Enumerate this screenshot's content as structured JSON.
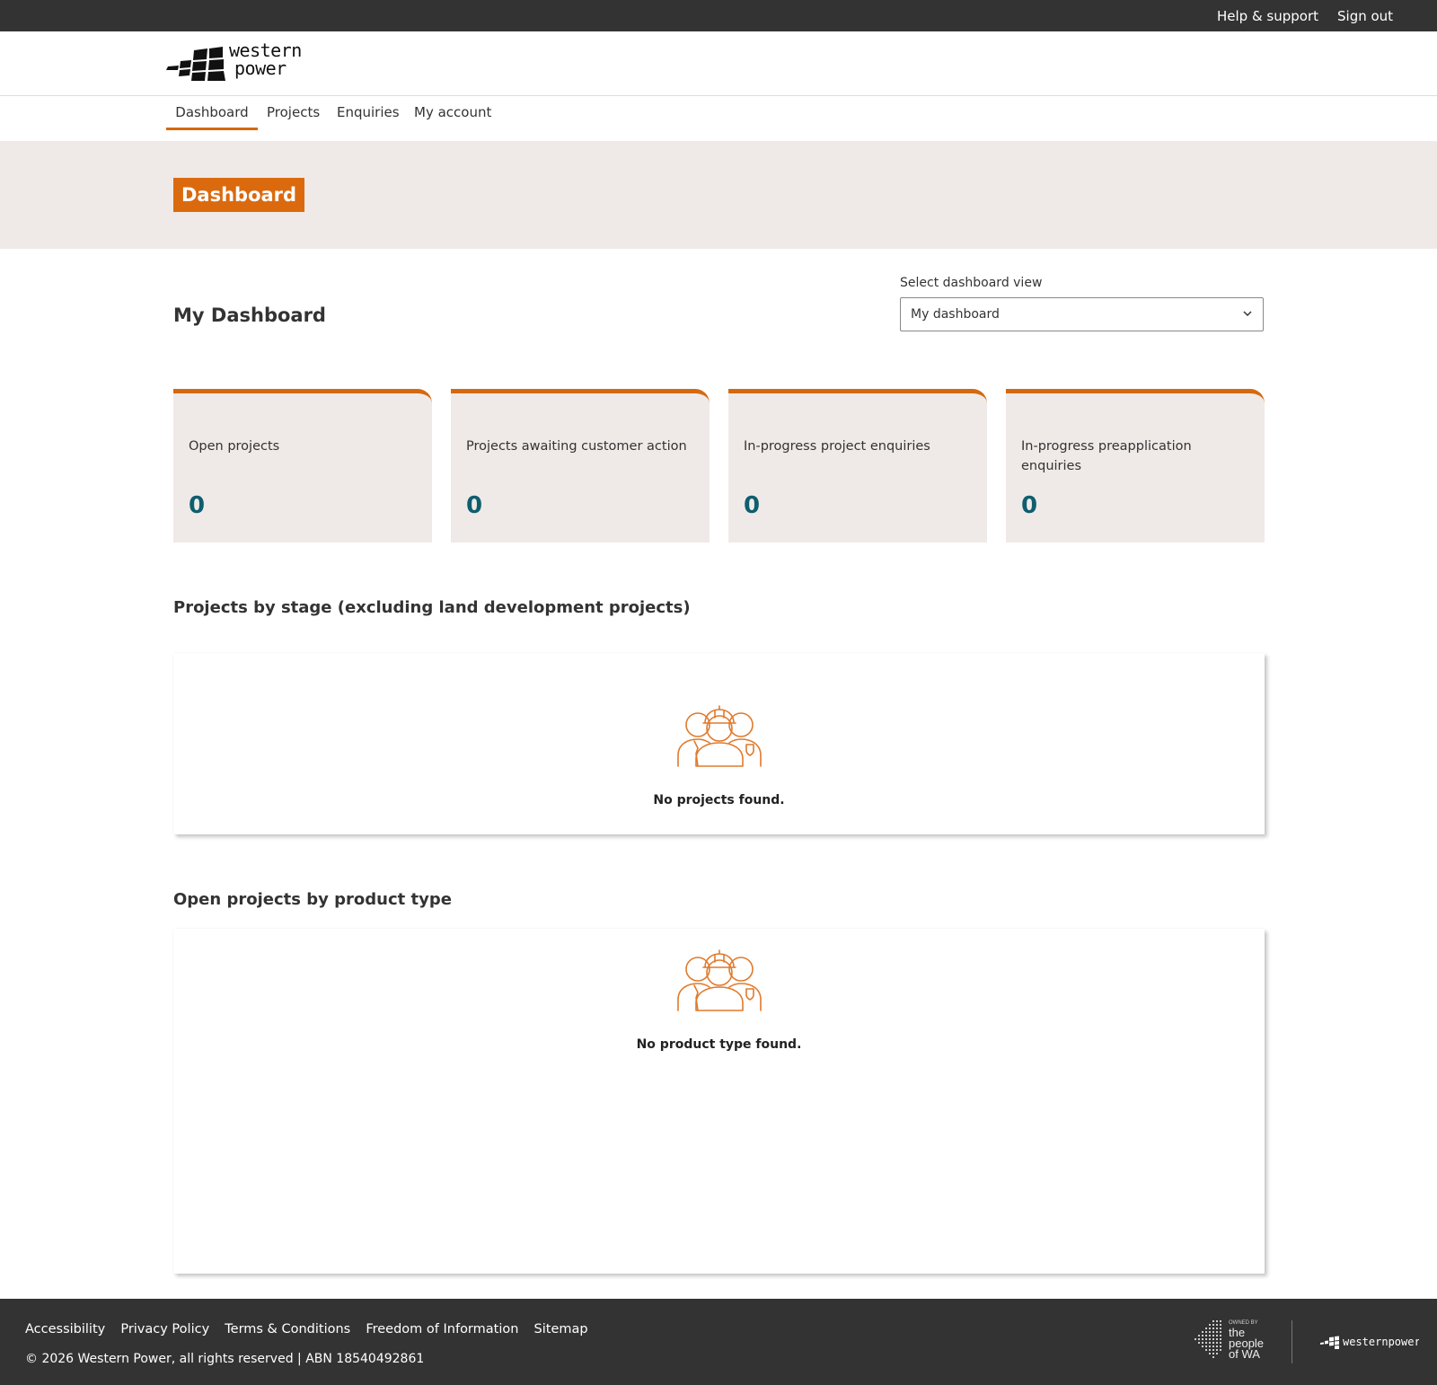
{
  "topbar": {
    "help": "Help & support",
    "signout": "Sign out"
  },
  "logo": {
    "line1": "western",
    "line2": "power"
  },
  "nav": {
    "items": [
      "Dashboard",
      "Projects",
      "Enquiries",
      "My account"
    ],
    "active": "Dashboard"
  },
  "banner": {
    "title": "Dashboard"
  },
  "main": {
    "heading": "My Dashboard",
    "select_label": "Select dashboard view",
    "select_value": "My dashboard"
  },
  "cards": [
    {
      "label": "Open projects",
      "value": "0"
    },
    {
      "label": "Projects awaiting customer action",
      "value": "0"
    },
    {
      "label": "In-progress project enquiries",
      "value": "0"
    },
    {
      "label": "In-progress preapplication enquiries",
      "value": "0"
    }
  ],
  "sections": [
    {
      "title": "Projects by stage (excluding land development projects)",
      "empty_message": "No projects found."
    },
    {
      "title": "Open projects by product type",
      "empty_message": "No product type found."
    }
  ],
  "footer": {
    "links": [
      "Accessibility",
      "Privacy Policy",
      "Terms & Conditions",
      "Freedom of Information",
      "Sitemap"
    ],
    "copyright": "© 2026 Western Power, all rights reserved | ABN 18540492861",
    "owned_by": {
      "small": "OWNED BY",
      "l1": "the",
      "l2": "people",
      "l3": "of WA"
    },
    "brand": "westernpower"
  },
  "colors": {
    "accent": "#D4690F",
    "banner_bg": "#EFEAE8",
    "number": "#0E5E6F",
    "dark": "#333333"
  }
}
